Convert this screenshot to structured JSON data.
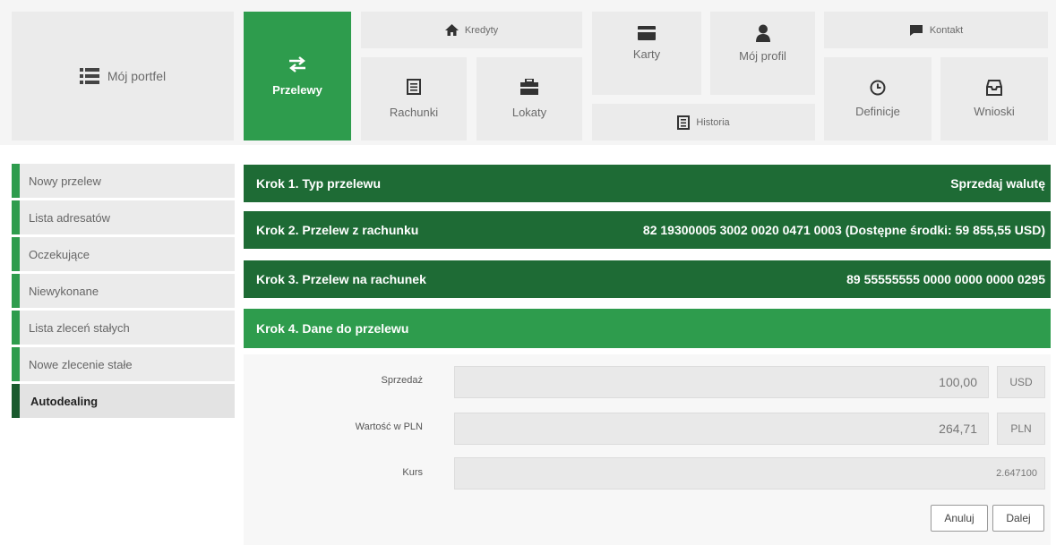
{
  "nav": {
    "portfel": "Mój portfel",
    "przelewy": "Przelewy",
    "kredyty": "Kredyty",
    "rachunki": "Rachunki",
    "lokaty": "Lokaty",
    "karty": "Karty",
    "profil": "Mój profil",
    "historia": "Historia",
    "kontakt": "Kontakt",
    "definicje": "Definicje",
    "wnioski": "Wnioski"
  },
  "sidebar": {
    "items": [
      {
        "label": "Nowy przelew"
      },
      {
        "label": "Lista adresatów"
      },
      {
        "label": "Oczekujące"
      },
      {
        "label": "Niewykonane"
      },
      {
        "label": "Lista zleceń stałych"
      },
      {
        "label": "Nowe zlecenie stałe"
      },
      {
        "label": "Autodealing"
      }
    ]
  },
  "steps": [
    {
      "title": "Krok 1. Typ przelewu",
      "value": "Sprzedaj walutę"
    },
    {
      "title": "Krok 2. Przelew z rachunku",
      "value": "82 19300005 3002 0020 0471 0003 (Dostępne środki: 59 855,55 USD)"
    },
    {
      "title": "Krok 3. Przelew na rachunek",
      "value": "89 55555555 0000 0000 0000 0295"
    },
    {
      "title": "Krok 4. Dane do przelewu",
      "value": ""
    }
  ],
  "form": {
    "sprzedaz_label": "Sprzedaż",
    "sprzedaz_value": "100,00",
    "sprzedaz_currency": "USD",
    "wartosc_label": "Wartość w PLN",
    "wartosc_value": "264,71",
    "wartosc_currency": "PLN",
    "kurs_label": "Kurs",
    "kurs_value": "2.647100"
  },
  "buttons": {
    "cancel": "Anuluj",
    "next": "Dalej"
  },
  "colors": {
    "accent": "#2e9c4d",
    "dark_accent": "#1e6b35"
  }
}
